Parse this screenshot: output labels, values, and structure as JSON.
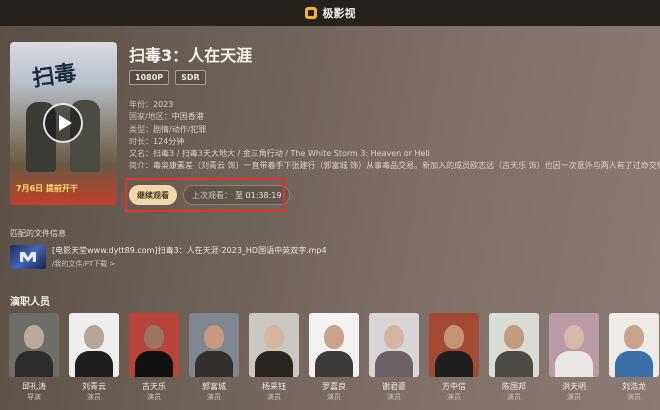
{
  "app": {
    "title": "极影视",
    "logo_icon": "app-logo-icon"
  },
  "movie": {
    "title": "扫毒3：人在天涯",
    "tags": [
      "1080P",
      "SDR"
    ],
    "poster_title": "扫毒",
    "poster_date": "7月6日 提前开干",
    "year_label": "年份：",
    "year": "2023",
    "region_label": "国家/地区：",
    "region": "中国香港",
    "genre_label": "类型：",
    "genre": "剧情/动作/犯罪",
    "duration_label": "时长：",
    "duration": "124分钟",
    "aka_label": "又名：",
    "aka": "扫毒3 / 扫毒3天大地大 / 金三角行动 / The White Storm 3: Heaven or Hell",
    "synopsis_label": "简介：",
    "synopsis": "毒枭康素差（刘青云 饰）一直带着手下张建行（郭富城 饰）从事毒品交易。新加入的成员欧志远（古天乐 饰）也因一次意外与两人有了过命交情。"
  },
  "actions": {
    "continue_label": "继续观看",
    "last_watch_label": "上次观看：",
    "last_watch_time": "至 01:38:19"
  },
  "file": {
    "heading": "匹配的文件信息",
    "name": "[电影天堂www.dytt89.com]扫毒3：人在天涯-2023_HD国语中英双字.mp4",
    "path": "/我的文件/PT下载 >"
  },
  "cast": {
    "heading": "演职人员",
    "members": [
      {
        "name": "邱礼涛",
        "role": "导演",
        "bg": "#6d6d6a",
        "skin": "#b9a99a",
        "cloth": "#2c2c2c"
      },
      {
        "name": "刘青云",
        "role": "演员",
        "bg": "#eeeeee",
        "skin": "#b5a597",
        "cloth": "#1e1e1e"
      },
      {
        "name": "古天乐",
        "role": "演员",
        "bg": "#b7433a",
        "skin": "#9a7560",
        "cloth": "#111111"
      },
      {
        "name": "郭富城",
        "role": "演员",
        "bg": "#7e8790",
        "skin": "#c69a80",
        "cloth": "#33302d"
      },
      {
        "name": "杨采钰",
        "role": "演员",
        "bg": "#c8c7c2",
        "skin": "#d6b4a0",
        "cloth": "#2b2522"
      },
      {
        "name": "罗嘉良",
        "role": "演员",
        "bg": "#f2f2f2",
        "skin": "#c9a48c",
        "cloth": "#3c3b3a"
      },
      {
        "name": "谢君豪",
        "role": "演员",
        "bg": "#d9d5d6",
        "skin": "#d4b3a2",
        "cloth": "#6a6266"
      },
      {
        "name": "方中信",
        "role": "演员",
        "bg": "#a24a33",
        "skin": "#c59476",
        "cloth": "#1f1f1f"
      },
      {
        "name": "陈国邦",
        "role": "演员",
        "bg": "#d9dbd6",
        "skin": "#c39a7e",
        "cloth": "#4d4a46"
      },
      {
        "name": "洪天明",
        "role": "演员",
        "bg": "#b99aa6",
        "skin": "#d7b7a8",
        "cloth": "#e9e6e3"
      },
      {
        "name": "刘浩龙",
        "role": "演员",
        "bg": "#ecebe8",
        "skin": "#c8a48e",
        "cloth": "#3b6fa8"
      }
    ]
  }
}
